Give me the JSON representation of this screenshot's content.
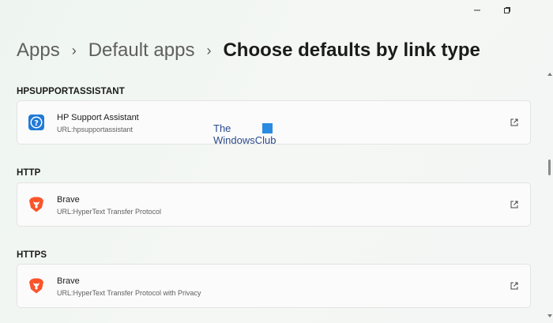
{
  "window": {
    "minimize_icon": "minimize-icon",
    "maximize_icon": "restore-icon"
  },
  "breadcrumb": {
    "items": [
      "Apps",
      "Default apps"
    ],
    "current": "Choose defaults by link type",
    "separator": "›"
  },
  "sections": [
    {
      "label": "HPSUPPORTASSISTANT",
      "app_name": "HP Support Assistant",
      "app_sub": "URL:hpsupportassistant",
      "icon": "hp-support-assistant-icon"
    },
    {
      "label": "HTTP",
      "app_name": "Brave",
      "app_sub": "URL:HyperText Transfer Protocol",
      "icon": "brave-icon"
    },
    {
      "label": "HTTPS",
      "app_name": "Brave",
      "app_sub": "URL:HyperText Transfer Protocol with Privacy",
      "icon": "brave-icon"
    }
  ],
  "watermark": {
    "line1": "The",
    "line2": "WindowsClub"
  },
  "colors": {
    "brave_orange": "#fb542b",
    "hp_blue": "#1f7ad6",
    "card_bg": "#fbfbfb",
    "text_secondary": "#606060"
  }
}
